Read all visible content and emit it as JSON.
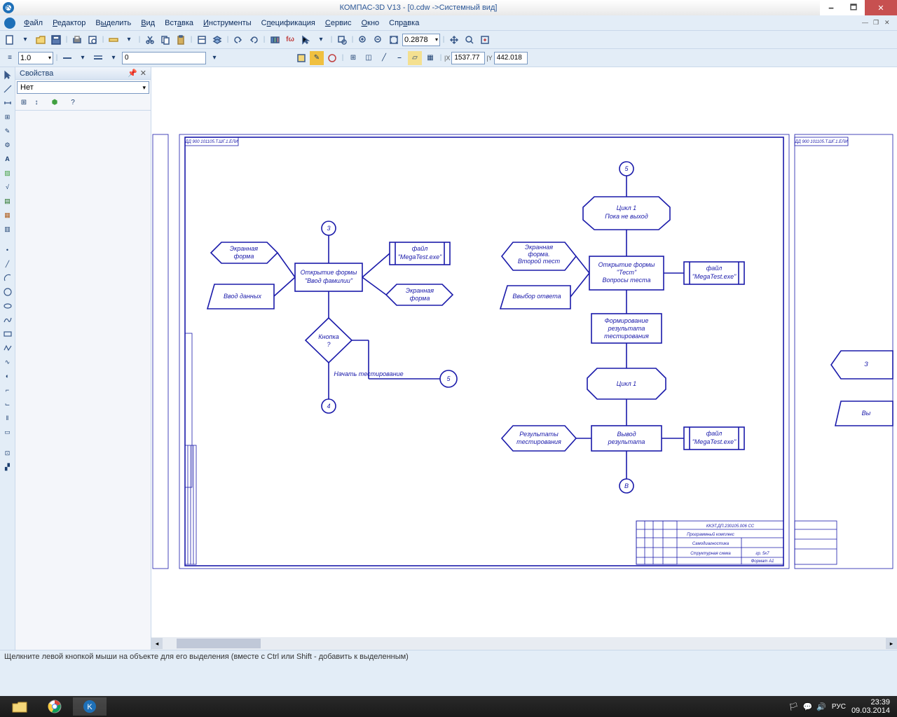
{
  "window": {
    "title": "КОМПАС-3D V13 - [0.cdw ->Системный вид]"
  },
  "menu": {
    "file": "Файл",
    "editor": "Редактор",
    "select": "Выделить",
    "view": "Вид",
    "insert": "Вставка",
    "tools": "Инструменты",
    "spec": "Спецификация",
    "service": "Сервис",
    "window": "Окно",
    "help": "Справка"
  },
  "toolbar2": {
    "scale": "1.0",
    "zero": "0",
    "zoom_pct": "0.2878",
    "coord_x_label": "|X",
    "coord_y_label": "|Y",
    "coord_x": "1537.77",
    "coord_y": "442.018"
  },
  "props": {
    "title": "Свойства",
    "combo": "Нет"
  },
  "dwg": {
    "page_label_left": "ДД 900 101105.Т.ШГ.1.ЕЛИ",
    "page_label_right": "ДД 900 101105.Т.ШГ.1.ЕЛИ",
    "conn3": "3",
    "conn4": "4",
    "conn5a": "5",
    "conn5b": "5",
    "connB": "В",
    "ekran_forma": "Экранная\nформа",
    "vvod_dan": "Ввод данных",
    "open_form_lnm": "Открытие формы\n\"Ввод фамилии\"",
    "file_mega1": "файл\n\"MegaTest.exe\"",
    "ekran_forma2": "Экранная\nформа",
    "knopka": "Кнопка\n?",
    "start_test": "Начать тестирование",
    "cycle1_hdr": "Цикл 1\nПока не выход",
    "ekran_forma_vt": "Экранная\nформа.\nВторой тест",
    "vybor_otv": "Ввыбор ответа",
    "open_form_test": "Открытие формы\n\"Тест\"\nВопросы теста",
    "file_mega2": "файл\n\"MegaTest.exe\"",
    "form_res": "Формирование\nрезультата\nтестирования",
    "cycle1": "Цикл 1",
    "res_test": "Результаты\nтестирования",
    "vyvod_res": "Вывод\nрезультата",
    "file_mega3": "файл\n\"MegaTest.exe\"",
    "z_frag": "З",
    "vy_frag": "Вы",
    "title_block_code": "ККЭТ.ДП.230105.006 СС",
    "title_block_r1": "Программный комплекс",
    "title_block_r2": "Самодиагностика",
    "title_block_r3": "Структурная схема",
    "title_block_gr": "гр. 5к7",
    "title_block_fmt": "Формат  А1"
  },
  "status": {
    "text": "Щелкните левой кнопкой мыши на объекте для его выделения (вместе с Ctrl или Shift - добавить к выделенным)"
  },
  "taskbar": {
    "lang": "РУС",
    "time": "23:39",
    "date": "09.03.2014"
  }
}
